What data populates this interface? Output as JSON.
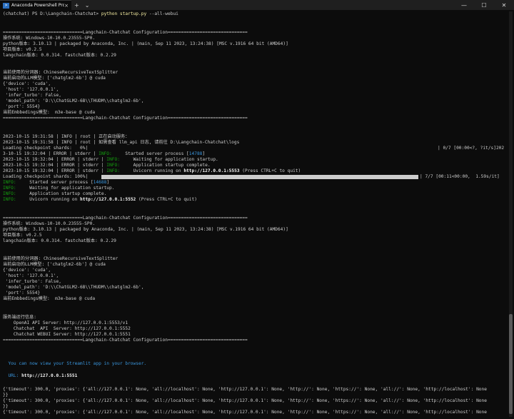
{
  "window": {
    "tab_title": "Anaconda Powershell Prompt",
    "tab_close": "×",
    "new_tab": "+",
    "dropdown": "⌄",
    "minimize": "—",
    "maximize": "☐",
    "close": "✕"
  },
  "terminal": {
    "prompt": "(chatchat) PS D:\\Langchain-Chatchat>",
    "command": "python startup.py",
    "command_args": "--all-webui",
    "cfg_header": "==============================Langchain-Chatchat Configuration==============================",
    "os_line": "操作系统: Windows-10-10.0.23555-SP0.",
    "python_line": "python版本: 3.10.13 | packaged by Anaconda, Inc. | (main, Sep 11 2023, 13:24:38) [MSC v.1916 64 bit (AMD64)]",
    "project_line": "项目版本: v0.2.5",
    "langchain_line": "langchain版本: 0.0.314. fastchat版本: 0.2.29",
    "splitter_line": "当前使用的分词器: ChineseRecursiveTextSplitter",
    "llm_line": "当前启动的LLM模型: ['chatglm2-6b'] @ cuda",
    "cfg_device": "{'device': 'cuda',",
    "cfg_host": " 'host': '127.0.0.1',",
    "cfg_turbo": " 'infer_turbo': False,",
    "cfg_path1": " 'model_path': 'D:\\\\ChatGLM2-6B\\\\THUDM\\\\chatglm2-6b',",
    "cfg_path2": " 'model_path': 'D:\\\\ChatGLM2-6B\\\\THUDM\\\\chatglm2-6b',",
    "cfg_port": " 'port': 5554}",
    "embed_line": "当前Embbedings模型:  m3e-base @ cuda",
    "footer": "==============================Langchain-Chatchat Configuration==============================",
    "log1": "2023-10-15 19:31:58 | INFO | root | 正在启动服务：",
    "log2": "2023-10-15 19:31:58 | INFO | root | 如需查看 llm_api 日志, 请前往 D:\\Langchain-Chatchat\\logs",
    "loading1": "Loading checkpoint shards:   0%|",
    "loading1_right": "| 0/7 [00:00<?, ?it/s]202",
    "err1_prefix": "3-10-15 19:32:04 | ERROR | stderr | ",
    "info_tag": "INFO:",
    "err1_msg": "     Started server process [",
    "pid1": "14788",
    "bracket_close": "]",
    "err2_prefix": "2023-10-15 19:32:04 | ERROR | stderr | ",
    "err2_msg": "     Waiting for application startup.",
    "err3_msg": "     Application startup complete.",
    "err4_msg": "     Uvicorn running on ",
    "url_5553": "http://127.0.0.1:5553",
    "ctrlc": " (Press CTRL+C to quit)",
    "loading2": "Loading checkpoint shards: 100%|",
    "loading2_right": "| 7/7 [00:11<00:00,  1.59s/it]",
    "info1_msg": "     Started server process [",
    "pid2": "14688",
    "info2_msg": "     Waiting for application startup.",
    "info3_msg": "     Application startup complete.",
    "info4_msg": "     Uvicorn running on ",
    "url_5552": "http://127.0.0.1:5552",
    "server_info": "服务端运行信息:",
    "openai_api": "    OpenAI API Server: http://127.0.0.1:5553/v1",
    "chatchat_api": "    Chatchat  API  Server: http://127.0.0.1:5552",
    "chatchat_webui": "    Chatchat WEBUI Server: http://127.0.0.1:5551",
    "streamlit_msg": "  You can now view your Streamlit app in your browser.",
    "url_label": "  URL: ",
    "url_5551": "http://127.0.0.1:5551",
    "timeout_line": "{'timeout': 300.0, 'proxies': {'all://127.0.0.1': None, 'all://localhost': None, 'http://127.0.0.1': None, 'http://': None, 'https://': None, 'all://': None, 'http://localhost': None",
    "close_brace": "}}"
  },
  "colors": {
    "background": "#0c0c0c",
    "text": "#cccccc",
    "info_green": "#13a10e",
    "pid_cyan": "#3a96dd",
    "command_yellow": "#f9f1a5"
  }
}
